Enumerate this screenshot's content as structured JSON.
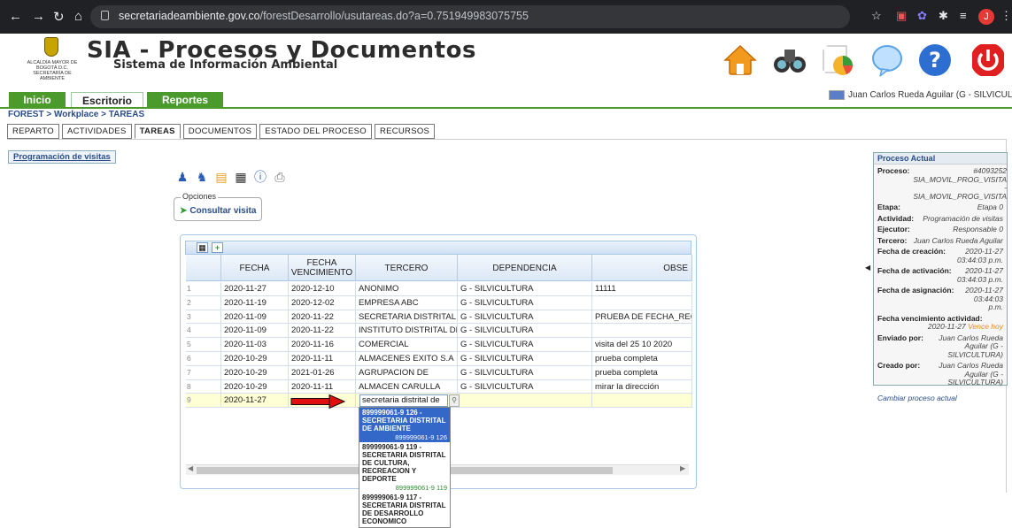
{
  "browser": {
    "url_domain": "secretariadeambiente.gov.co",
    "url_path": "/forestDesarrollo/usutareas.do?a=0.751949983075755",
    "avatar_letter": "J"
  },
  "header": {
    "title": "SIA - Procesos y Documentos",
    "subtitle": "Sistema de Información Ambiental",
    "logo_text": "ALCALDÍA MAYOR DE BOGOTÁ D.C. SECRETARÍA DE AMBIENTE"
  },
  "nav": {
    "tabs": [
      "Inicio",
      "Escritorio",
      "Reportes"
    ],
    "user": "Juan Carlos Rueda Aguilar (G - SILVICULTURA)"
  },
  "breadcrumb": "FOREST > Workplace > TAREAS",
  "subtabs": [
    "REPARTO",
    "ACTIVIDADES",
    "TAREAS",
    "DOCUMENTOS",
    "ESTADO DEL PROCESO",
    "RECURSOS"
  ],
  "programacion_label": "Programación de visitas",
  "opciones": {
    "legend": "Opciones",
    "link": "Consultar visita"
  },
  "grid": {
    "columns": [
      "",
      "FECHA",
      "FECHA VENCIMIENTO",
      "TERCERO",
      "DEPENDENCIA",
      "OBSE"
    ],
    "rows": [
      [
        "1",
        "2020-11-27",
        "2020-12-10",
        "ANONIMO",
        "G - SILVICULTURA",
        "11111"
      ],
      [
        "2",
        "2020-11-19",
        "2020-12-02",
        "EMPRESA ABC",
        "G - SILVICULTURA",
        ""
      ],
      [
        "3",
        "2020-11-09",
        "2020-11-22",
        "SECRETARIA DISTRITAL",
        "G - SILVICULTURA",
        "PRUEBA DE FECHA_REC"
      ],
      [
        "4",
        "2020-11-09",
        "2020-11-22",
        "INSTITUTO DISTRITAL DE",
        "G - SILVICULTURA",
        ""
      ],
      [
        "5",
        "2020-11-03",
        "2020-11-16",
        "COMERCIAL",
        "G - SILVICULTURA",
        "visita del 25 10 2020"
      ],
      [
        "6",
        "2020-10-29",
        "2020-11-11",
        "ALMACENES EXITO S.A",
        "G - SILVICULTURA",
        "prueba completa"
      ],
      [
        "7",
        "2020-10-29",
        "2021-01-26",
        "AGRUPACION DE",
        "G - SILVICULTURA",
        "prueba completa"
      ],
      [
        "8",
        "2020-10-29",
        "2020-11-11",
        "ALMACEN CARULLA",
        "G - SILVICULTURA",
        "mirar la dirección"
      ],
      [
        "9",
        "2020-11-27",
        "",
        "",
        "",
        ""
      ]
    ],
    "editor_value": "secretaria distrital de"
  },
  "dropdown": [
    {
      "title": "899999061-9 126 - SECRETARIA DISTRITAL DE AMBIENTE",
      "code": "899999061-9 126",
      "selected": true
    },
    {
      "title": "899999061-9 119 - SECRETARIA DISTRITAL DE CULTURA, RECREACION Y DEPORTE",
      "code": "899999061-9 119",
      "selected": false
    },
    {
      "title": "899999061-9 117 - SECRETARIA DISTRITAL DE DESARROLLO ECONOMICO",
      "code": "899999061-9 117",
      "selected": false
    }
  ],
  "proceso": {
    "title": "Proceso Actual",
    "proceso_label": "Proceso:",
    "proceso_value": "#4093252 SIA_MOVIL_PROG_VISITA - SIA_MOVIL_PROG_VISITA",
    "etapa_label": "Etapa:",
    "etapa_value": "Etapa 0",
    "actividad_label": "Actividad:",
    "actividad_value": "Programación de visitas",
    "ejecutor_label": "Ejecutor:",
    "ejecutor_value": "Responsable 0",
    "tercero_label": "Tercero:",
    "tercero_value": "Juan Carlos Rueda Aguilar",
    "creacion_label": "Fecha de creación:",
    "creacion_value": "2020-11-27 03:44:03 p.m.",
    "activacion_label": "Fecha de activación:",
    "activacion_value": "2020-11-27 03:44:03 p.m.",
    "asignacion_label": "Fecha de asignación:",
    "asignacion_value": "2020-11-27 03:44:03 p.m.",
    "vencimiento_label": "Fecha vencimiento actividad:",
    "vencimiento_value": "2020-11-27",
    "vence_hoy": "Vence hoy",
    "enviado_label": "Enviado por:",
    "enviado_value": "Juan Carlos Rueda Aguilar (G - SILVICULTURA)",
    "creado_label": "Creado por:",
    "creado_value": "Juan Carlos Rueda Aguilar (G - SILVICULTURA)",
    "change_link": "Cambiar proceso actual"
  },
  "colors": {
    "nav_green": "#4a9a2c",
    "link_blue": "#2a4d8a",
    "selected_blue": "#3468c8",
    "arrow_red": "#e01010"
  }
}
